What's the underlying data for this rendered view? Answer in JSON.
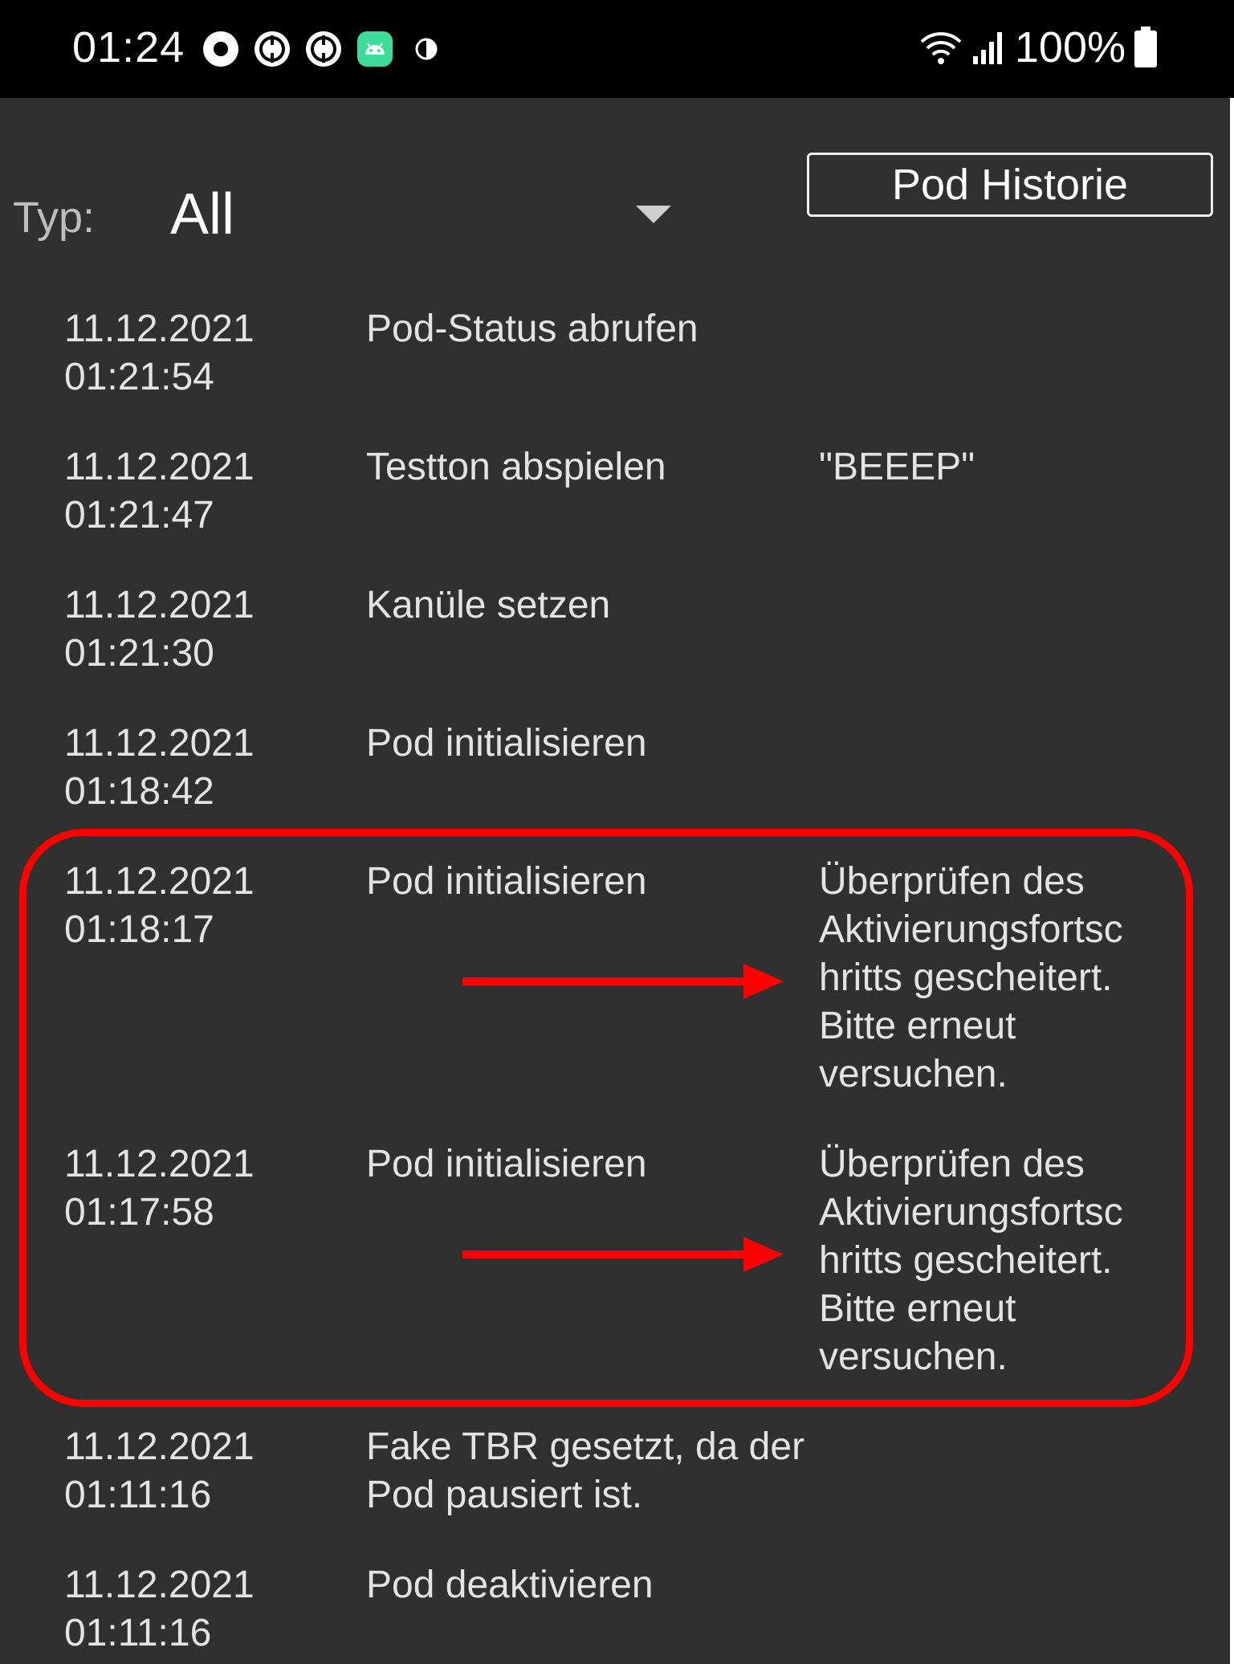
{
  "status_bar": {
    "time": "01:24",
    "battery": "100%",
    "icons": [
      "record-icon",
      "sync-icon",
      "sync-icon",
      "android-app-icon",
      "contrast-icon"
    ],
    "right_icons": [
      "wifi-icon",
      "signal-icon",
      "battery-icon"
    ]
  },
  "filter": {
    "label": "Typ:",
    "selected": "All"
  },
  "toolbar": {
    "history_label": "Pod Historie"
  },
  "colors": {
    "background": "#303030",
    "highlight": "#ff0000",
    "text": "#e3e3e3"
  },
  "log": [
    {
      "date": "11.12.2021\n01:21:54",
      "action": "Pod-Status abrufen",
      "message": ""
    },
    {
      "date": "11.12.2021\n01:21:47",
      "action": "Testton abspielen",
      "message": "\"BEEEP\""
    },
    {
      "date": "11.12.2021\n01:21:30",
      "action": "Kanüle setzen",
      "message": ""
    },
    {
      "date": "11.12.2021\n01:18:42",
      "action": "Pod initialisieren",
      "message": ""
    },
    {
      "date": "11.12.2021\n01:18:17",
      "action": "Pod initialisieren",
      "message": "Überprüfen des\nAktivierungsfortsc\nhritts gescheitert.\nBitte erneut\nversuchen."
    },
    {
      "date": "11.12.2021\n01:17:58",
      "action": "Pod initialisieren",
      "message": "Überprüfen des\nAktivierungsfortsc\nhritts gescheitert.\nBitte erneut\nversuchen."
    },
    {
      "date": "11.12.2021\n01:11:16",
      "action": "Fake TBR gesetzt, da der\nPod pausiert ist.",
      "message": ""
    },
    {
      "date": "11.12.2021\n01:11:16",
      "action": "Pod deaktivieren",
      "message": ""
    }
  ]
}
